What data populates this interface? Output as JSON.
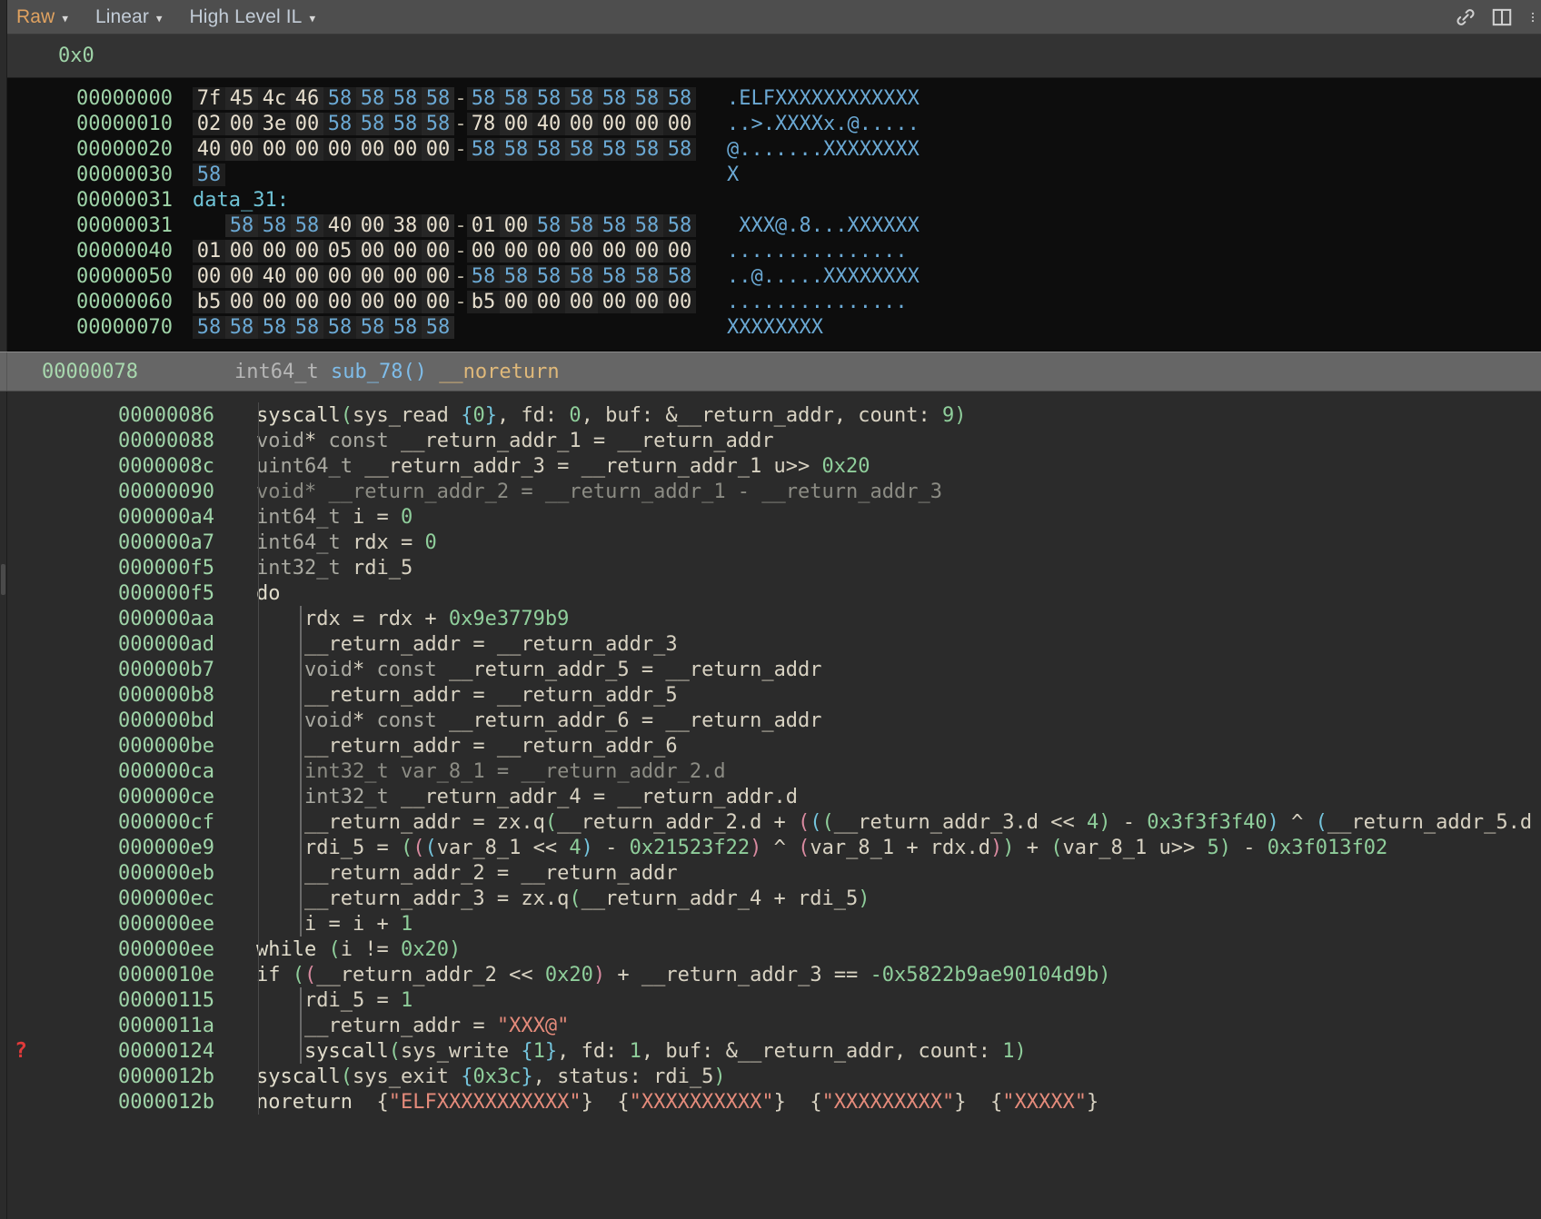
{
  "toolbar": {
    "views": [
      {
        "label": "Raw",
        "color": "#e0a260",
        "name": "view-mode-raw"
      },
      {
        "label": "Linear",
        "color": "#c3cdd8",
        "name": "view-mode-linear"
      },
      {
        "label": "High Level IL",
        "color": "#c3cdd8",
        "name": "view-mode-hlil"
      }
    ],
    "caret": "▼",
    "icons": [
      "link-icon",
      "split-pane-icon",
      "more-options-icon"
    ]
  },
  "address_strip": {
    "value": "0x0"
  },
  "hex": {
    "rows": [
      {
        "addr": "00000000",
        "bytes": [
          "7f",
          "45",
          "4c",
          "46",
          "58",
          "58",
          "58",
          "58",
          "-",
          "58",
          "58",
          "58",
          "58",
          "58",
          "58",
          "58"
        ],
        "ascii": ".ELFXXXXXXXXXXXX"
      },
      {
        "addr": "00000010",
        "bytes": [
          "02",
          "00",
          "3e",
          "00",
          "58",
          "58",
          "58",
          "58",
          "-",
          "78",
          "00",
          "40",
          "00",
          "00",
          "00",
          "00"
        ],
        "ascii": "..>.XXXXx.@....."
      },
      {
        "addr": "00000020",
        "bytes": [
          "40",
          "00",
          "00",
          "00",
          "00",
          "00",
          "00",
          "00",
          "-",
          "58",
          "58",
          "58",
          "58",
          "58",
          "58",
          "58"
        ],
        "ascii": "@.......XXXXXXXX"
      },
      {
        "addr": "00000030",
        "bytes": [
          "58"
        ],
        "ascii": "X"
      },
      {
        "addr": "00000031",
        "label": "data_31:"
      },
      {
        "addr": "00000031",
        "bytes": [
          "",
          "58",
          "58",
          "58",
          "40",
          "00",
          "38",
          "00",
          "-",
          "01",
          "00",
          "58",
          "58",
          "58",
          "58",
          "58"
        ],
        "ascii": " XXX@.8...XXXXXX"
      },
      {
        "addr": "00000040",
        "bytes": [
          "01",
          "00",
          "00",
          "00",
          "05",
          "00",
          "00",
          "00",
          "-",
          "00",
          "00",
          "00",
          "00",
          "00",
          "00",
          "00"
        ],
        "ascii": "..............."
      },
      {
        "addr": "00000050",
        "bytes": [
          "00",
          "00",
          "40",
          "00",
          "00",
          "00",
          "00",
          "00",
          "-",
          "58",
          "58",
          "58",
          "58",
          "58",
          "58",
          "58"
        ],
        "ascii": "..@.....XXXXXXXX"
      },
      {
        "addr": "00000060",
        "bytes": [
          "b5",
          "00",
          "00",
          "00",
          "00",
          "00",
          "00",
          "00",
          "-",
          "b5",
          "00",
          "00",
          "00",
          "00",
          "00",
          "00"
        ],
        "ascii": "..............."
      },
      {
        "addr": "00000070",
        "bytes": [
          "58",
          "58",
          "58",
          "58",
          "58",
          "58",
          "58",
          "58"
        ],
        "ascii": "XXXXXXXX"
      }
    ]
  },
  "function_header": {
    "addr": "00000078",
    "return_type": "int64_t",
    "name": "sub_78()",
    "annotation": "__noreturn"
  },
  "code": {
    "rows": [
      {
        "addr": "00000086",
        "mark": "",
        "indent": 0,
        "text": "syscall(sys_read {0}, fd: 0, buf: &__return_addr, count: 9)"
      },
      {
        "addr": "00000088",
        "mark": "",
        "indent": 0,
        "text": "void* const __return_addr_1 = __return_addr"
      },
      {
        "addr": "0000008c",
        "mark": "",
        "indent": 0,
        "text": "uint64_t __return_addr_3 = __return_addr_1 u>> 0x20"
      },
      {
        "addr": "00000090",
        "mark": "",
        "indent": 0,
        "text": "void* __return_addr_2 = __return_addr_1 - __return_addr_3",
        "dim": true
      },
      {
        "addr": "000000a4",
        "mark": "",
        "indent": 0,
        "text": "int64_t i = 0"
      },
      {
        "addr": "000000a7",
        "mark": "",
        "indent": 0,
        "text": "int64_t rdx = 0"
      },
      {
        "addr": "000000f5",
        "mark": "",
        "indent": 0,
        "text": "int32_t rdi_5"
      },
      {
        "addr": "000000f5",
        "mark": "",
        "indent": 0,
        "text": "do"
      },
      {
        "addr": "000000aa",
        "mark": "",
        "indent": 1,
        "text": "rdx = rdx + 0x9e3779b9"
      },
      {
        "addr": "000000ad",
        "mark": "",
        "indent": 1,
        "text": "__return_addr = __return_addr_3"
      },
      {
        "addr": "000000b7",
        "mark": "",
        "indent": 1,
        "text": "void* const __return_addr_5 = __return_addr"
      },
      {
        "addr": "000000b8",
        "mark": "",
        "indent": 1,
        "text": "__return_addr = __return_addr_5"
      },
      {
        "addr": "000000bd",
        "mark": "",
        "indent": 1,
        "text": "void* const __return_addr_6 = __return_addr"
      },
      {
        "addr": "000000be",
        "mark": "",
        "indent": 1,
        "text": "__return_addr = __return_addr_6"
      },
      {
        "addr": "000000ca",
        "mark": "",
        "indent": 1,
        "text": "int32_t var_8_1 = __return_addr_2.d",
        "dim": true
      },
      {
        "addr": "000000ce",
        "mark": "",
        "indent": 1,
        "text": "int32_t __return_addr_4 = __return_addr.d"
      },
      {
        "addr": "000000cf",
        "mark": "",
        "indent": 1,
        "text": "__return_addr = zx.q(__return_addr_2.d + (((__return_addr_3.d << 4) - 0x3f3f3f40) ^ (__return_addr_5.d"
      },
      {
        "addr": "000000e9",
        "mark": "",
        "indent": 1,
        "text": "rdi_5 = (((var_8_1 << 4) - 0x21523f22) ^ (var_8_1 + rdx.d)) + (var_8_1 u>> 5) - 0x3f013f02"
      },
      {
        "addr": "000000eb",
        "mark": "",
        "indent": 1,
        "text": "__return_addr_2 = __return_addr"
      },
      {
        "addr": "000000ec",
        "mark": "",
        "indent": 1,
        "text": "__return_addr_3 = zx.q(__return_addr_4 + rdi_5)"
      },
      {
        "addr": "000000ee",
        "mark": "",
        "indent": 1,
        "text": "i = i + 1"
      },
      {
        "addr": "000000ee",
        "mark": "",
        "indent": 0,
        "text": "while (i != 0x20)"
      },
      {
        "addr": "0000010e",
        "mark": "",
        "indent": 0,
        "text": "if ((__return_addr_2 << 0x20) + __return_addr_3 == -0x5822b9ae90104d9b)"
      },
      {
        "addr": "00000115",
        "mark": "",
        "indent": 1,
        "text": "rdi_5 = 1"
      },
      {
        "addr": "0000011a",
        "mark": "",
        "indent": 1,
        "text": "__return_addr = \"XXX@\""
      },
      {
        "addr": "00000124",
        "mark": "?",
        "indent": 1,
        "text": "syscall(sys_write {1}, fd: 1, buf: &__return_addr, count: 1)"
      },
      {
        "addr": "0000012b",
        "mark": "",
        "indent": 0,
        "text": "syscall(sys_exit {0x3c}, status: rdi_5)"
      },
      {
        "addr": "0000012b",
        "mark": "",
        "indent": 0,
        "text": "noreturn  {\"ELFXXXXXXXXXXX\"}  {\"XXXXXXXXXX\"}  {\"XXXXXXXXX\"}  {\"XXXXX\"}"
      }
    ]
  },
  "colors": {
    "toolbar_bg": "#4e4e4e",
    "hex_bg": "#0d0d0d",
    "code_bg": "#2b2b2b",
    "selection_bg": "#666666",
    "address_green": "#9fd4a8",
    "hex_blue": "#6ba9d4",
    "accent_orange": "#e0a260",
    "error_red": "#e03a3a"
  }
}
